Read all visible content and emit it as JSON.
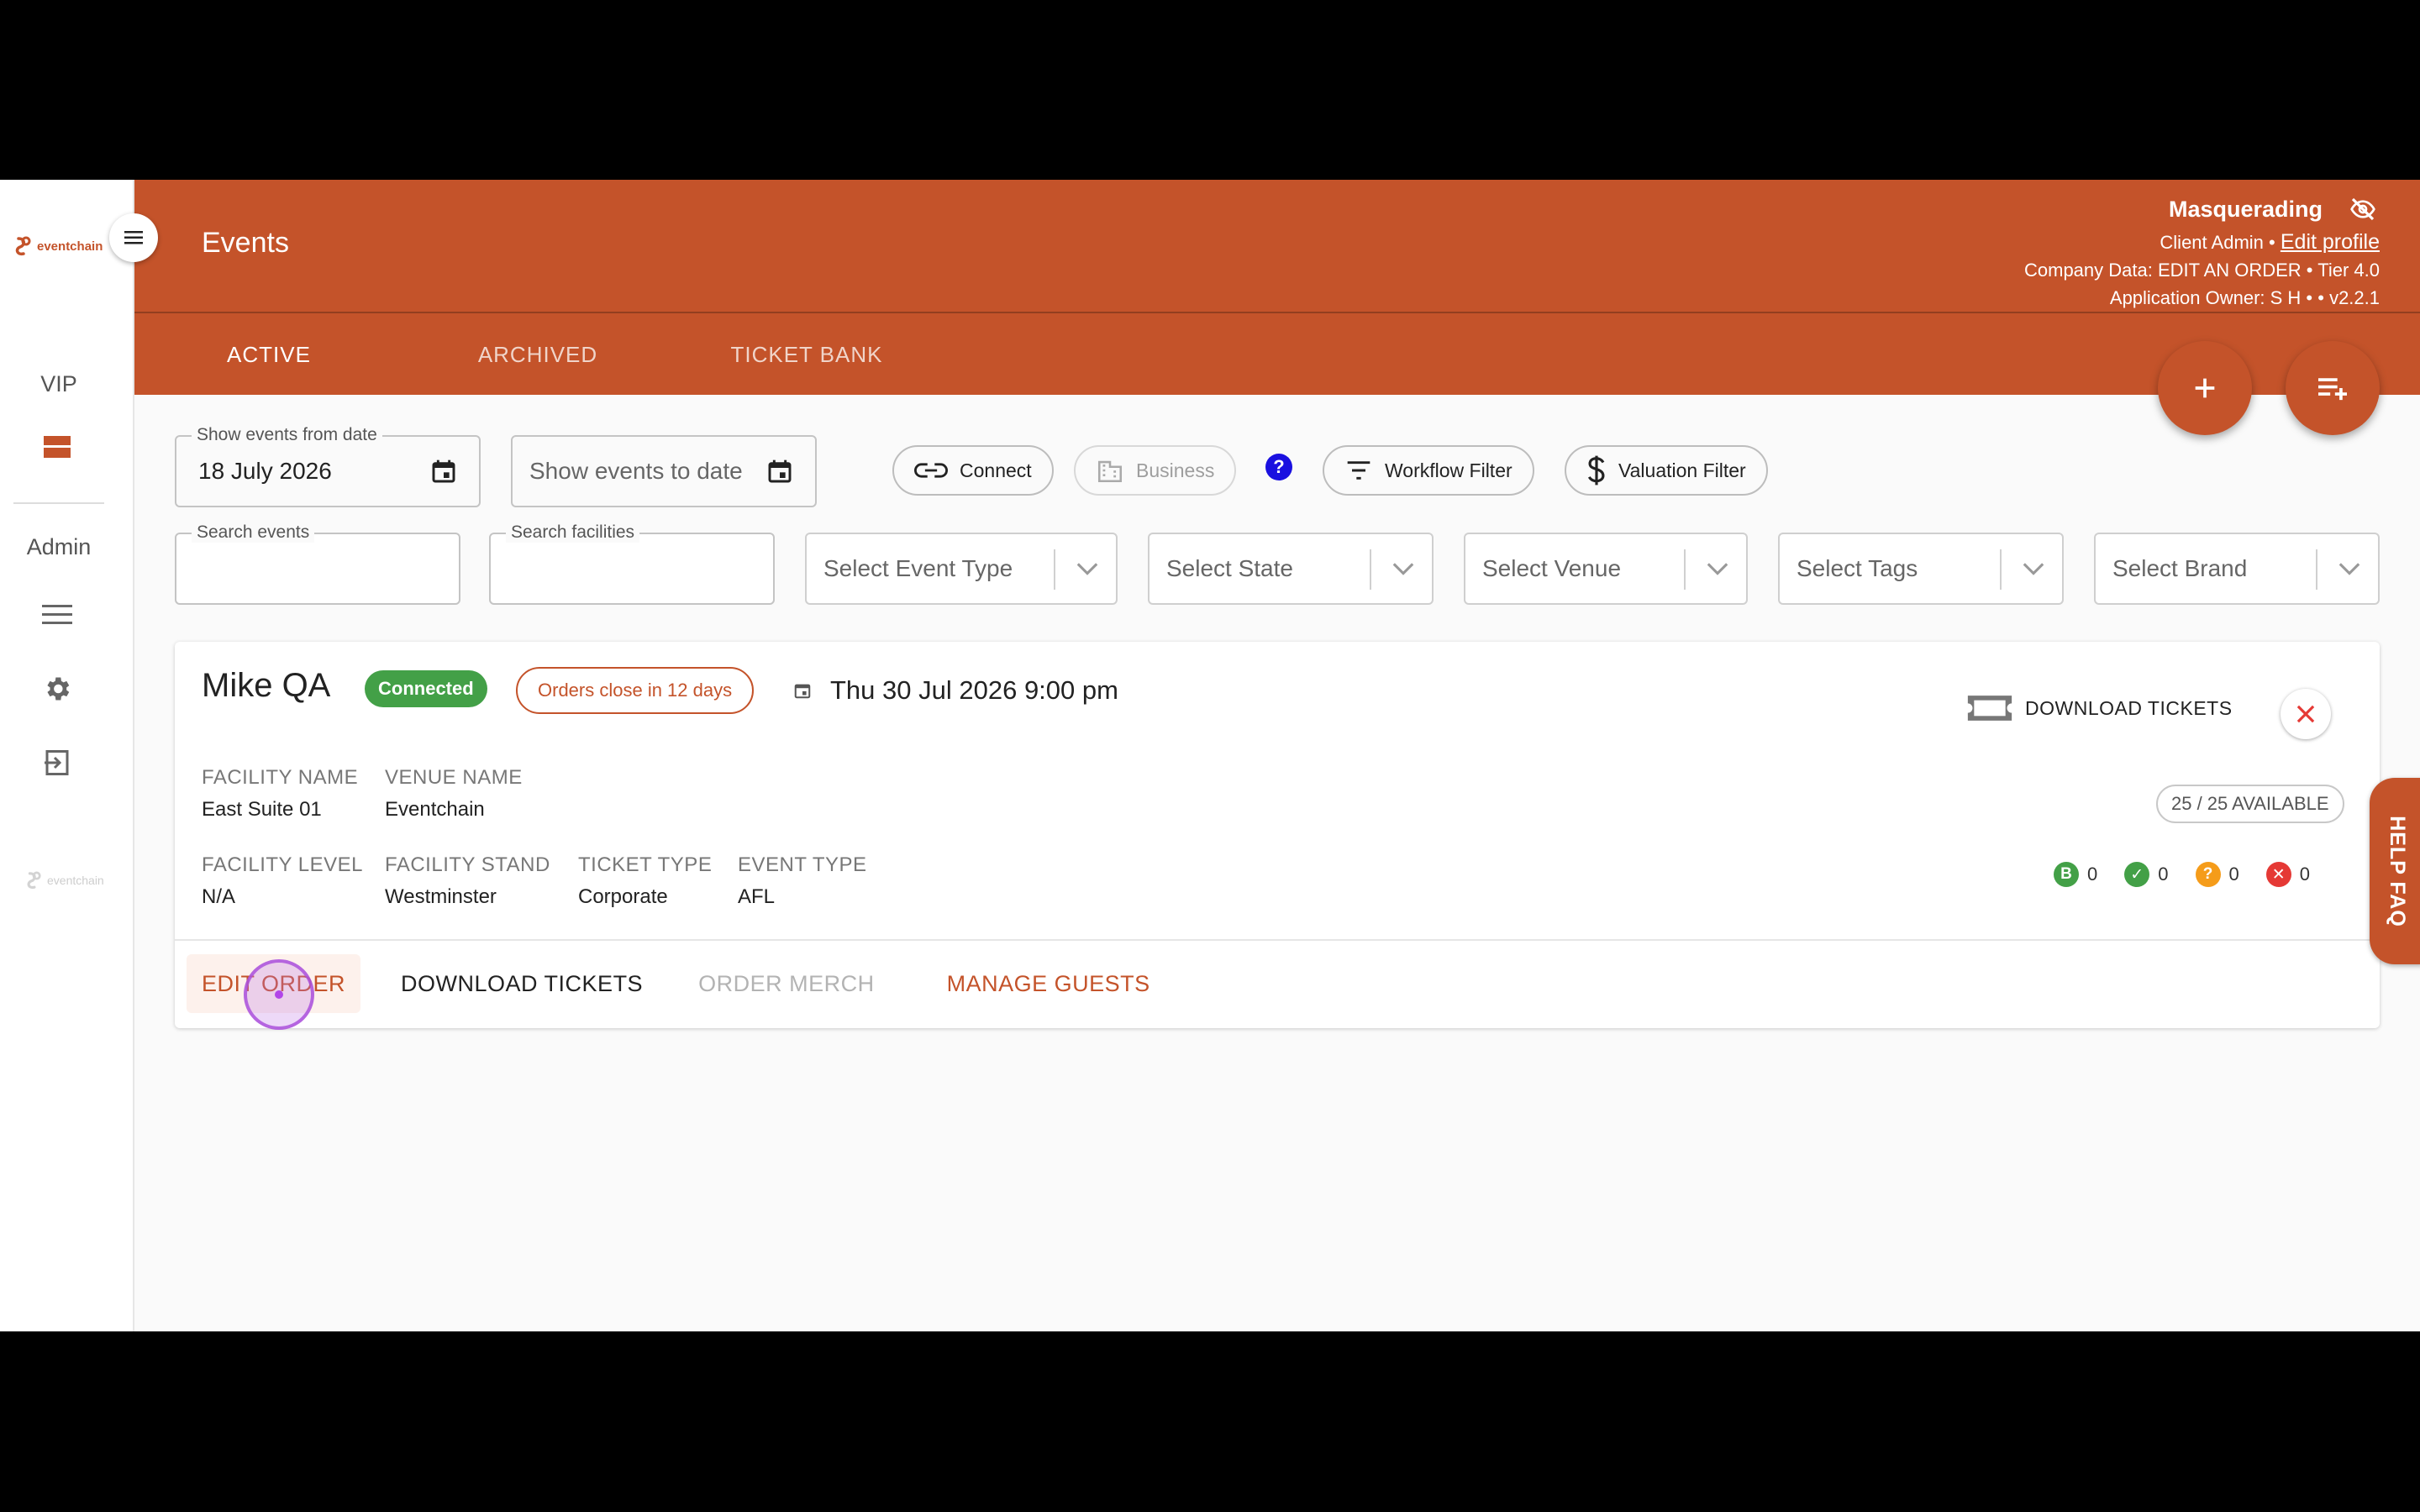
{
  "app": {
    "logo_text": "eventchain",
    "page_title": "Events"
  },
  "sidebar": {
    "vip_label": "VIP",
    "admin_label": "Admin",
    "footer_logo_text": "eventchain"
  },
  "header": {
    "masquerading": "Masquerading",
    "role": "Client Admin",
    "separator": "•",
    "edit_profile": "Edit profile",
    "company_data": "Company Data: EDIT AN ORDER • Tier 4.0",
    "app_owner": "Application Owner: S H • • v2.2.1"
  },
  "tabs": [
    {
      "label": "ACTIVE",
      "active": true
    },
    {
      "label": "ARCHIVED",
      "active": false
    },
    {
      "label": "TICKET BANK",
      "active": false
    }
  ],
  "filters": {
    "from_date_label": "Show events from date",
    "from_date_value": "18 July 2026",
    "to_date_placeholder": "Show events to date",
    "connect_label": "Connect",
    "business_label": "Business",
    "help_label": "?",
    "workflow_filter_label": "Workflow Filter",
    "valuation_filter_label": "Valuation Filter",
    "search_events_label": "Search events",
    "search_facilities_label": "Search facilities",
    "selects": [
      {
        "placeholder": "Select Event Type"
      },
      {
        "placeholder": "Select State"
      },
      {
        "placeholder": "Select Venue"
      },
      {
        "placeholder": "Select Tags"
      },
      {
        "placeholder": "Select Brand"
      }
    ]
  },
  "event": {
    "title": "Mike QA",
    "status_badge": "Connected",
    "orders_close": "Orders close in 12 days",
    "datetime": "Thu 30 Jul 2026 9:00 pm",
    "download_tickets_top": "DOWNLOAD TICKETS",
    "availability": "25 / 25 AVAILABLE",
    "fields": {
      "facility_name_label": "FACILITY NAME",
      "facility_name": "East Suite 01",
      "venue_name_label": "VENUE NAME",
      "venue_name": "Eventchain",
      "facility_level_label": "FACILITY LEVEL",
      "facility_level": "N/A",
      "facility_stand_label": "FACILITY STAND",
      "facility_stand": "Westminster",
      "ticket_type_label": "TICKET TYPE",
      "ticket_type": "Corporate",
      "event_type_label": "EVENT TYPE",
      "event_type": "AFL"
    },
    "status_counts": [
      {
        "symbol": "B",
        "count": "0",
        "color": "#43a047"
      },
      {
        "symbol": "✓",
        "count": "0",
        "color": "#43a047"
      },
      {
        "symbol": "?",
        "count": "0",
        "color": "#f59c1a"
      },
      {
        "symbol": "✕",
        "count": "0",
        "color": "#e53935"
      }
    ],
    "actions": {
      "edit_order": "EDIT ORDER",
      "download_tickets": "DOWNLOAD TICKETS",
      "order_merch": "ORDER MERCH",
      "manage_guests": "MANAGE GUESTS"
    }
  },
  "help_faq": "HELP FAQ",
  "colors": {
    "brand": "#c4532a",
    "connected": "#43a047",
    "help_blue": "#1a10e0"
  }
}
